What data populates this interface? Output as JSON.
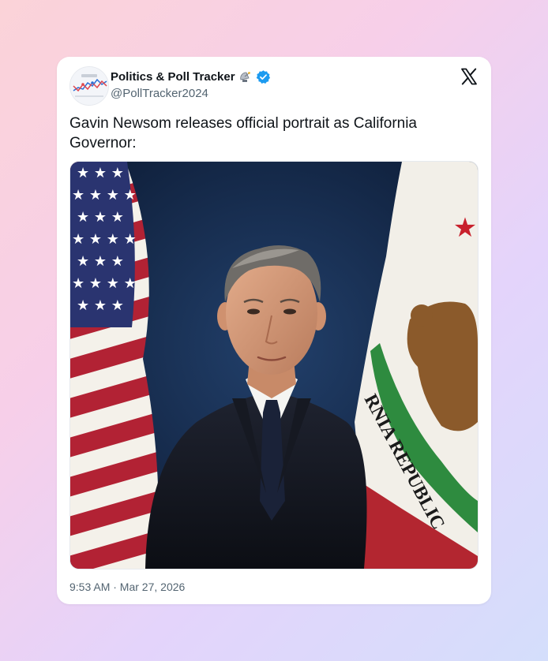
{
  "account": {
    "display_name": "Politics & Poll Tracker",
    "handle": "@PollTracker2024",
    "verified": true,
    "badge_emoji_icon": "satellite-dish-icon"
  },
  "post": {
    "text": "Gavin Newsom releases official portrait as California Governor:",
    "timestamp": "9:53 AM · Mar 27, 2026",
    "flag_banner_text": "RNIA REPUBLIC"
  },
  "colors": {
    "verified_blue": "#1d9bf0",
    "text_primary": "#0f1419",
    "text_secondary": "#536471",
    "backdrop_navy": "#132a4a",
    "flag_red": "#b22234",
    "flag_blue": "#3c3b6e",
    "bear_brown": "#8b5a2b",
    "grass_green": "#2e8b3f"
  }
}
